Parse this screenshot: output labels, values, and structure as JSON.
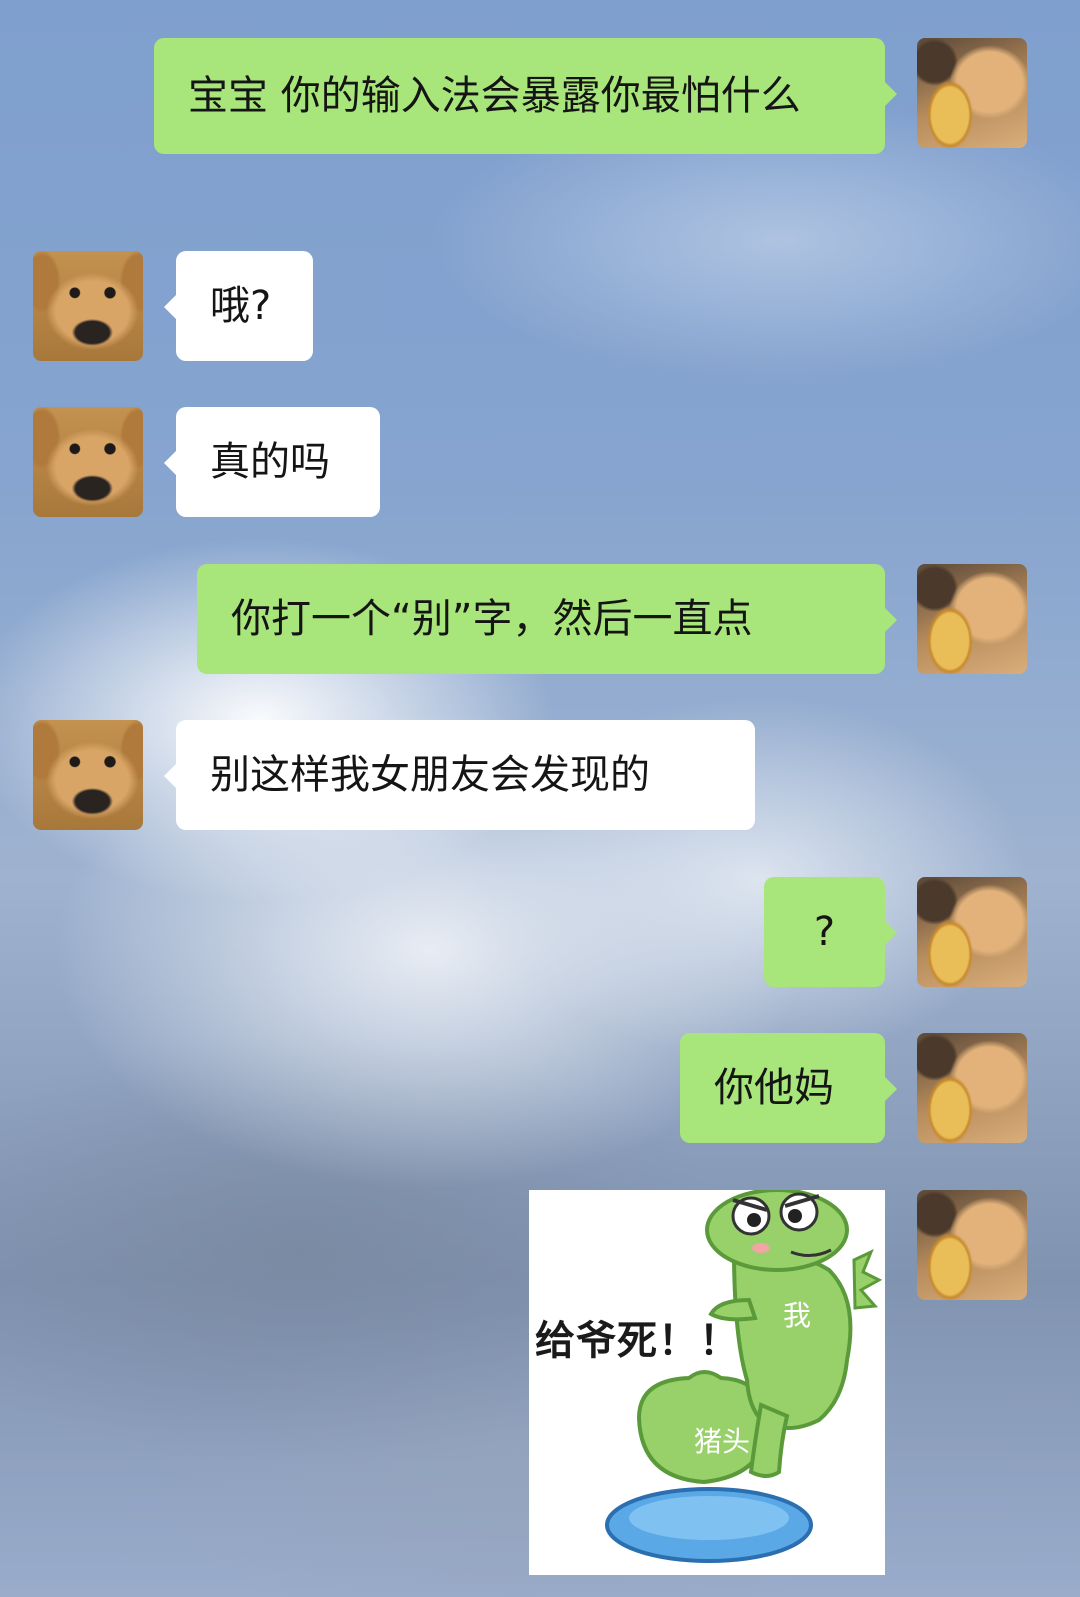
{
  "messages": [
    {
      "sender": "me",
      "text": "宝宝 你的输入法会暴露你最怕什么"
    },
    {
      "sender": "them",
      "text": "哦?"
    },
    {
      "sender": "them",
      "text": "真的吗"
    },
    {
      "sender": "me",
      "text": "你打一个“别”字，然后一直点"
    },
    {
      "sender": "them",
      "text": "别这样我女朋友会发现的"
    },
    {
      "sender": "me",
      "text": "?"
    },
    {
      "sender": "me",
      "text": "你他妈"
    }
  ],
  "sticker": {
    "caption": "给爷死！！",
    "label_me": "我",
    "label_pig": "猪头"
  },
  "avatars": {
    "me": "cat-avatar",
    "them": "dog-avatar"
  },
  "colors": {
    "my_bubble": "#a8e57a",
    "their_bubble": "#ffffff"
  }
}
